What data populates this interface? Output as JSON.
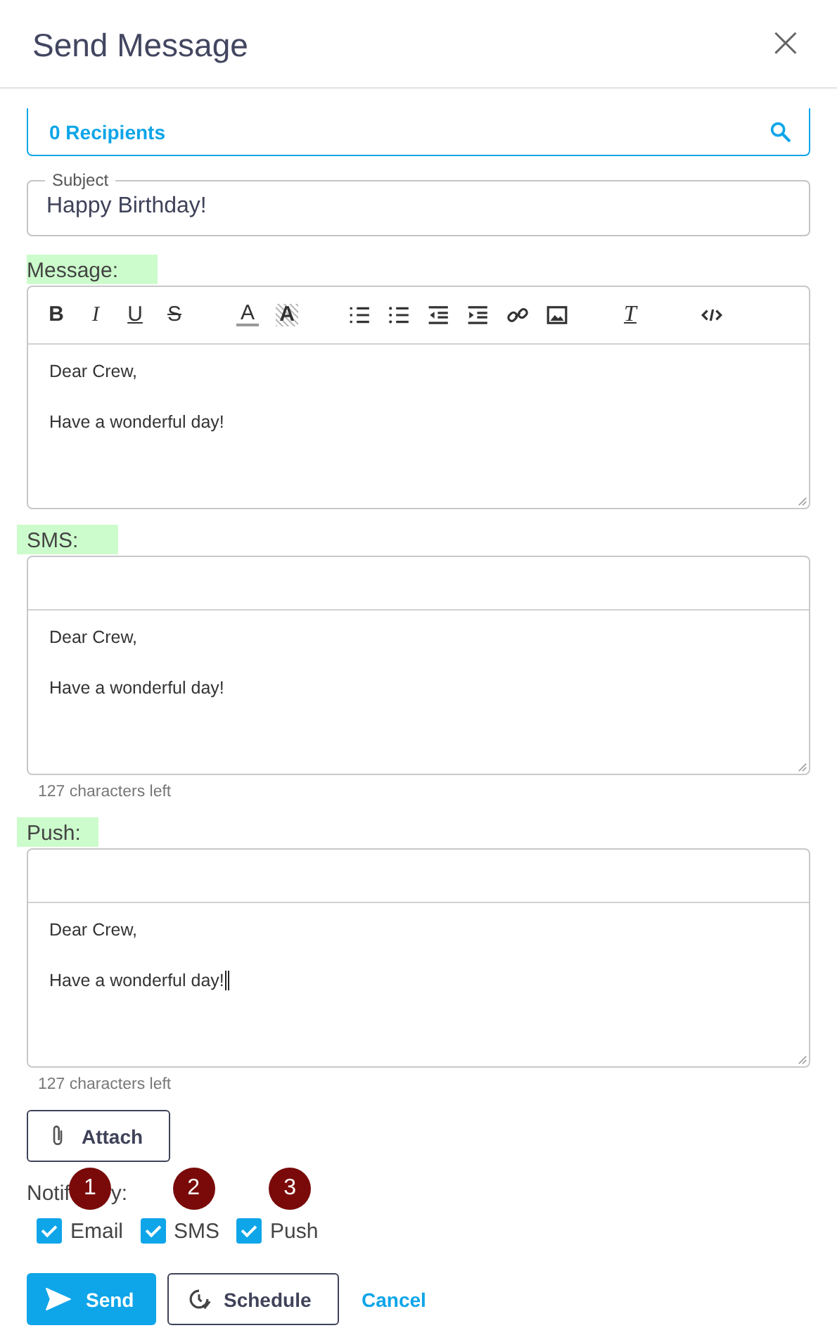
{
  "dialog": {
    "title": "Send Message",
    "close_glyph": "×"
  },
  "recipients": {
    "value": "0 Recipients"
  },
  "subject": {
    "label": "Subject",
    "value": "Happy Birthday!"
  },
  "message": {
    "label": "Message:",
    "toolbar": [
      [
        {
          "kind": "bold",
          "glyph": "B"
        },
        {
          "kind": "italic",
          "glyph": "I"
        },
        {
          "kind": "underline",
          "glyph": "U"
        },
        {
          "kind": "strike",
          "glyph": "S"
        }
      ],
      [
        {
          "kind": "color",
          "glyph": "A"
        },
        {
          "kind": "highlight",
          "glyph": "A"
        }
      ],
      [
        {
          "kind": "ordered-list"
        },
        {
          "kind": "bullet-list"
        },
        {
          "kind": "outdent"
        },
        {
          "kind": "indent"
        },
        {
          "kind": "link"
        },
        {
          "kind": "image"
        }
      ],
      [
        {
          "kind": "clear-format",
          "glyph": "T"
        }
      ],
      [
        {
          "kind": "code"
        }
      ]
    ],
    "paragraphs": [
      "Dear Crew,",
      "Have a wonderful day!"
    ]
  },
  "sms": {
    "label": "SMS:",
    "paragraphs": [
      "Dear Crew,",
      "Have a wonderful day!"
    ],
    "counter": "127 characters left",
    "focused": false
  },
  "push": {
    "label": "Push:",
    "paragraphs": [
      "Dear Crew,",
      "Have a wonderful day!"
    ],
    "counter": "127 characters left",
    "focused": true
  },
  "attach_button": "Attach",
  "notify": {
    "label_parts": [
      "Notif",
      "y:"
    ],
    "options": [
      {
        "label": "Email",
        "checked": true,
        "badge": "1"
      },
      {
        "label": "SMS",
        "checked": true,
        "badge": "2"
      },
      {
        "label": "Push",
        "checked": true,
        "badge": "3"
      }
    ]
  },
  "actions": {
    "send": "Send",
    "schedule": "Schedule",
    "cancel": "Cancel"
  }
}
